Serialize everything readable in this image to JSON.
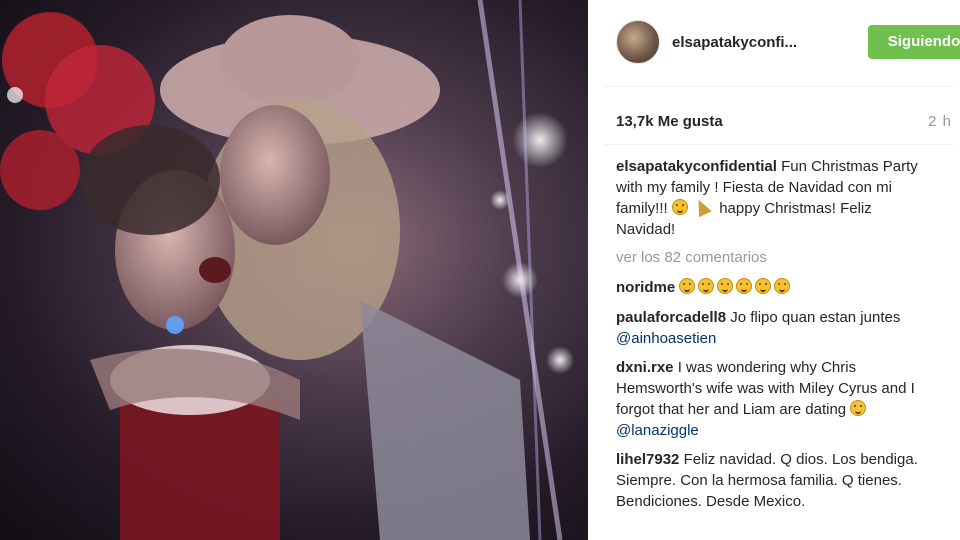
{
  "post": {
    "image_alt": "Two women posing together at a Christmas party with festive lights"
  },
  "header": {
    "username": "elsapatakyconfi...",
    "follow_button": "Siguiendo"
  },
  "stats": {
    "likes": "13,7k Me gusta",
    "time": "2 h"
  },
  "caption": {
    "username": "elsapatakyconfidential",
    "text_part1": "Fun Christmas Party with my family ! Fiesta de Navidad con mi family!!!",
    "text_part2": "happy Christmas! Feliz Navidad!",
    "emojis": [
      "winking-tongue-face-icon",
      "party-popper-icon"
    ]
  },
  "comments": {
    "view_all": "ver los 82 comentarios",
    "items": [
      {
        "username": "noridme",
        "text": "",
        "emojis": [
          "smile",
          "smile",
          "smile",
          "smile",
          "smile",
          "smile"
        ]
      },
      {
        "username": "paulaforcadell8",
        "text": "Jo flipo quan estan juntes",
        "mention": "@ainhoasetien"
      },
      {
        "username": "dxni.rxe",
        "text": "I was wondering why Chris Hemsworth's wife was with Miley Cyrus and I forgot that her and Liam are dating",
        "emoji": "laughing-crying-face-icon",
        "mention": "@lanaziggle"
      },
      {
        "username": "lihel7932",
        "text": "Feliz navidad. Q dios. Los bendiga. Siempre. Con la hermosa familia. Q tienes. Bendiciones. Desde Mexico."
      }
    ]
  },
  "colors": {
    "follow_button_bg": "#70c050",
    "mention": "#003569",
    "muted": "#999999"
  }
}
